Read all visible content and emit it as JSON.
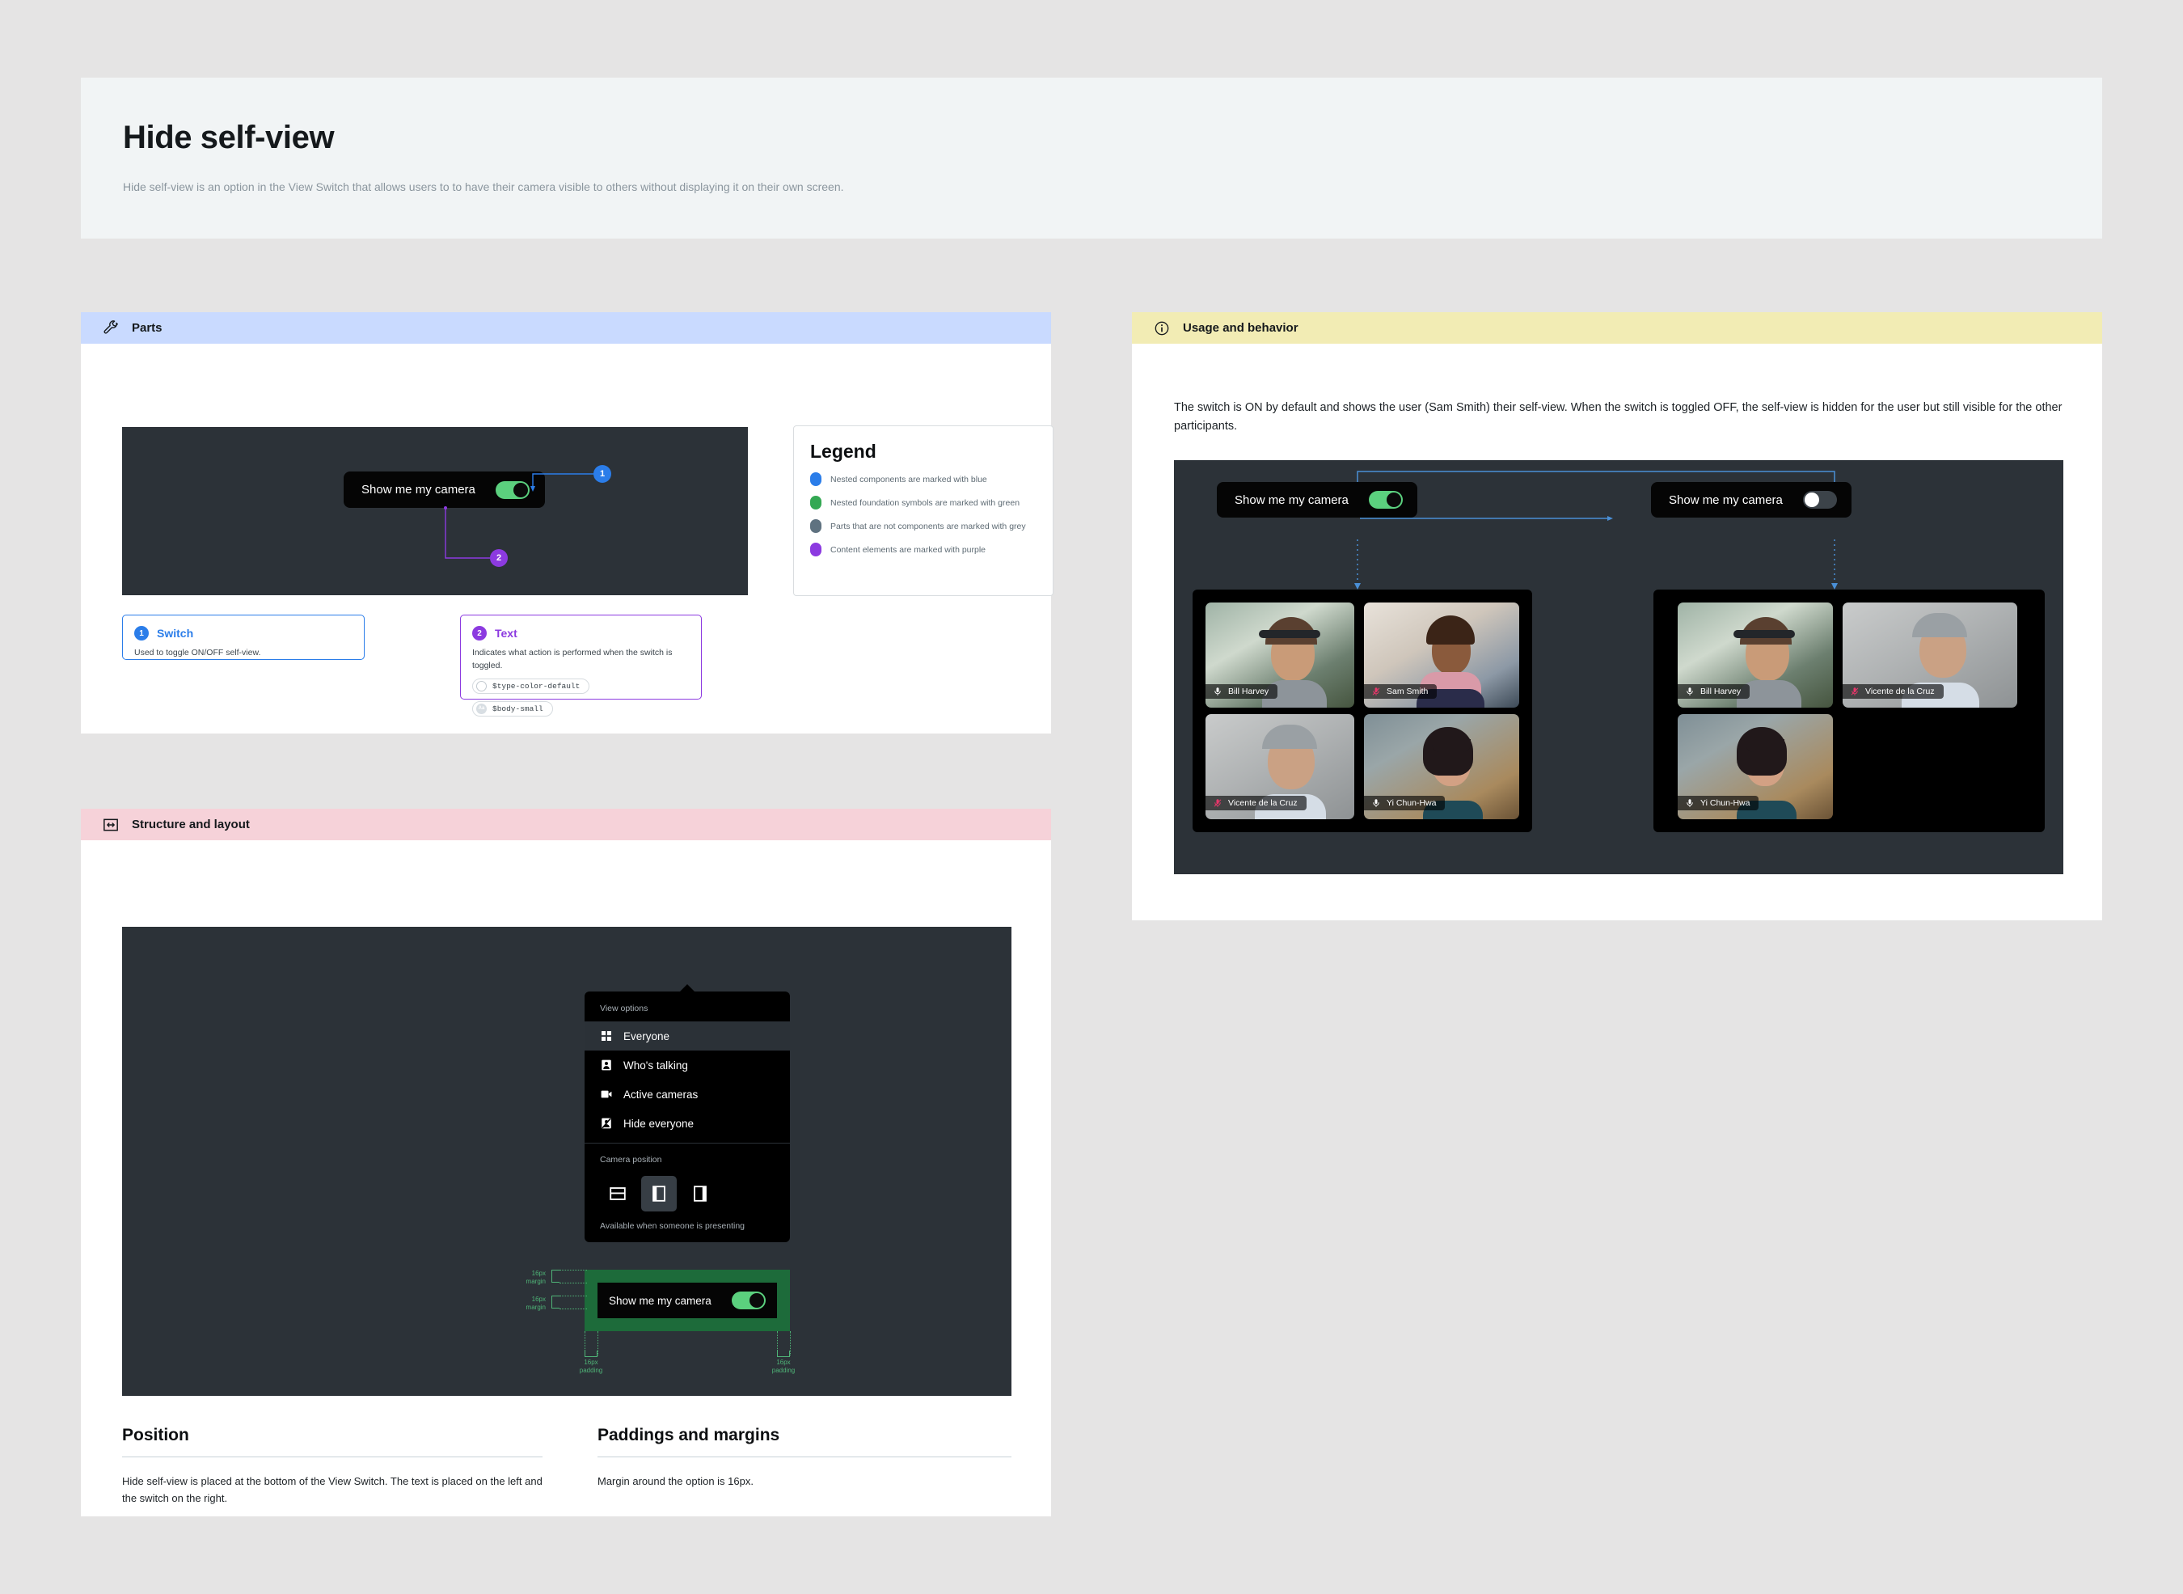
{
  "hero": {
    "title": "Hide self-view",
    "subtitle": "Hide self-view is an option in the View Switch that allows users to to have their camera visible to others without displaying it on their own screen."
  },
  "sections": {
    "parts": {
      "title": "Parts",
      "icon": "wrench-icon"
    },
    "usage": {
      "title": "Usage and behavior",
      "icon": "info-icon"
    },
    "structure": {
      "title": "Structure and layout",
      "icon": "resize-icon"
    }
  },
  "parts": {
    "diagram": {
      "toggle_label": "Show me my camera",
      "toggle_state": "on",
      "callouts": [
        {
          "number": "1",
          "color": "#2b7de9"
        },
        {
          "number": "2",
          "color": "#8c3ae0"
        }
      ]
    },
    "legend": {
      "title": "Legend",
      "items": [
        {
          "color": "#2b7de9",
          "text": "Nested components are marked with blue"
        },
        {
          "color": "#34a853",
          "text": "Nested foundation symbols are marked with green"
        },
        {
          "color": "#5f7280",
          "text": "Parts that are not components are marked with grey"
        },
        {
          "color": "#8c3ae0",
          "text": "Content elements are marked with purple"
        }
      ]
    },
    "cards": [
      {
        "number": "1",
        "title": "Switch",
        "color": "#2b7de9",
        "description": "Used to toggle ON/OFF self-view.",
        "tokens": []
      },
      {
        "number": "2",
        "title": "Text",
        "color": "#8c3ae0",
        "description": "Indicates what action is performed when the switch is toggled.",
        "tokens": [
          {
            "label": "$type-color-default",
            "swatch": "empty"
          },
          {
            "label": "$body-small",
            "swatch": "aa"
          }
        ]
      }
    ]
  },
  "usage": {
    "body": "The switch is ON by default and shows the user (Sam Smith) their self-view. When the switch is toggled OFF, the self-view is hidden for the user but still visible for the other participants.",
    "left": {
      "toggle_label": "Show me my camera",
      "toggle_state": "on",
      "participants": [
        {
          "name": "Bill Harvey",
          "muted": false
        },
        {
          "name": "Sam Smith",
          "muted": true
        },
        {
          "name": "Vicente de la Cruz",
          "muted": true
        },
        {
          "name": "Yi Chun-Hwa",
          "muted": false
        }
      ]
    },
    "right": {
      "toggle_label": "Show me my camera",
      "toggle_state": "off",
      "participants": [
        {
          "name": "Bill Harvey",
          "muted": false
        },
        {
          "name": "Vicente de la Cruz",
          "muted": true
        },
        {
          "name": "Yi Chun-Hwa",
          "muted": false
        }
      ]
    }
  },
  "structure": {
    "menu": {
      "section_label": "View options",
      "items": [
        {
          "label": "Everyone",
          "icon": "grid-icon",
          "active": true
        },
        {
          "label": "Who's talking",
          "icon": "person-icon",
          "active": false
        },
        {
          "label": "Active cameras",
          "icon": "video-icon",
          "active": false
        },
        {
          "label": "Hide everyone",
          "icon": "person-slash-icon",
          "active": false
        }
      ],
      "camera_position_label": "Camera position",
      "camera_position_note": "Available when someone is presenting",
      "camera_position_options": [
        {
          "icon": "layout-top-icon",
          "selected": false
        },
        {
          "icon": "layout-left-icon",
          "selected": true
        },
        {
          "icon": "layout-right-icon",
          "selected": false
        }
      ],
      "selfview_label": "Show me my camera",
      "selfview_state": "on"
    },
    "measurements": [
      {
        "value": "16px",
        "unit": "margin"
      },
      {
        "value": "16px",
        "unit": "margin"
      },
      {
        "value": "16px",
        "unit": "padding"
      },
      {
        "value": "16px",
        "unit": "padding"
      }
    ],
    "columns": [
      {
        "heading": "Position",
        "body": "Hide self-view is placed at the bottom of the View Switch. The text is placed on the left and the switch on the right."
      },
      {
        "heading": "Paddings and margins",
        "body": "Margin around the option is 16px."
      }
    ]
  }
}
